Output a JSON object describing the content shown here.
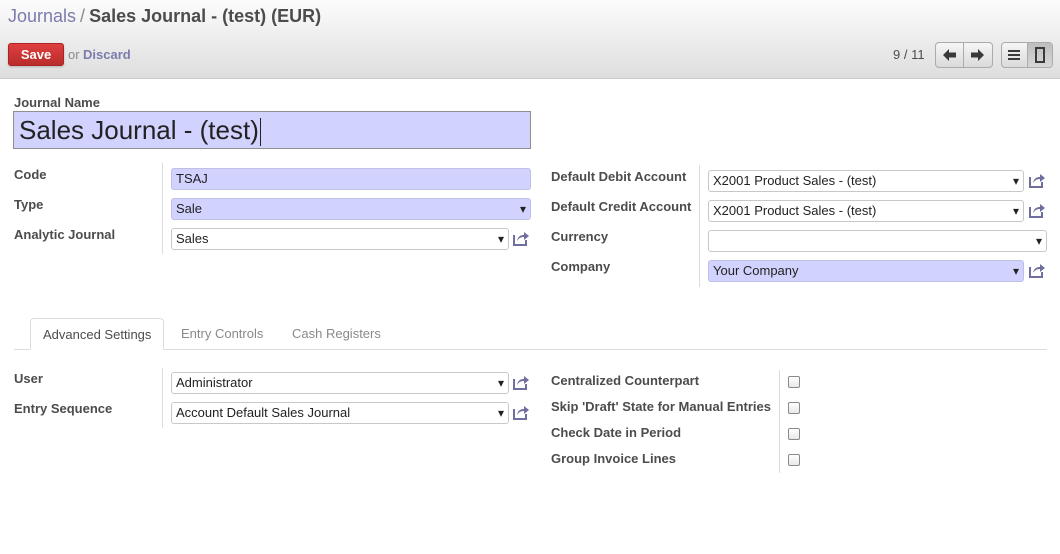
{
  "breadcrumb": {
    "parent": "Journals",
    "separator": "/",
    "current": "Sales Journal - (test) (EUR)"
  },
  "toolbar": {
    "save_label": "Save",
    "or_text": "or",
    "discard_label": "Discard"
  },
  "pager": {
    "text": "9 / 11"
  },
  "icons": {
    "prev": "arrow-left-icon",
    "next": "arrow-right-icon",
    "list_view": "list-view-icon",
    "form_view": "form-view-icon",
    "external": "external-link-icon"
  },
  "colors": {
    "required_bg": "#d2d2ff",
    "link": "#7c7bad",
    "save": "#c83333"
  },
  "form": {
    "name_label": "Journal Name",
    "name_value": "Sales Journal - (test)",
    "left": {
      "code": {
        "label": "Code",
        "value": "TSAJ"
      },
      "type": {
        "label": "Type",
        "value": "Sale"
      },
      "analytic_journal": {
        "label": "Analytic Journal",
        "value": "Sales"
      }
    },
    "right": {
      "default_debit": {
        "label": "Default Debit Account",
        "value": "X2001 Product Sales - (test)"
      },
      "default_credit": {
        "label": "Default Credit Account",
        "value": "X2001 Product Sales - (test)"
      },
      "currency": {
        "label": "Currency",
        "value": ""
      },
      "company": {
        "label": "Company",
        "value": "Your Company"
      }
    }
  },
  "tabs": [
    {
      "label": "Advanced Settings",
      "active": true
    },
    {
      "label": "Entry Controls",
      "active": false
    },
    {
      "label": "Cash Registers",
      "active": false
    }
  ],
  "advanced": {
    "user": {
      "label": "User",
      "value": "Administrator"
    },
    "entry_sequence": {
      "label": "Entry Sequence",
      "value": "Account Default Sales Journal"
    },
    "checkboxes": [
      {
        "label": "Centralized Counterpart",
        "checked": false
      },
      {
        "label": "Skip 'Draft' State for Manual Entries",
        "checked": false
      },
      {
        "label": "Check Date in Period",
        "checked": false
      },
      {
        "label": "Group Invoice Lines",
        "checked": false
      }
    ]
  }
}
